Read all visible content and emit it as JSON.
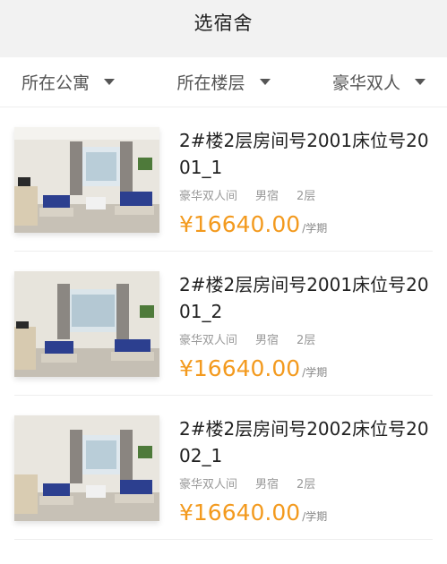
{
  "header": {
    "title": "选宿舍"
  },
  "filters": [
    {
      "label": "所在公寓"
    },
    {
      "label": "所在楼层"
    },
    {
      "label": "豪华双人"
    }
  ],
  "rooms": [
    {
      "title": "2#楼2层房间号2001床位号2001_1",
      "type": "豪华双人间",
      "gender": "男宿",
      "floor": "2层",
      "price": "¥16640.00",
      "unit": "/学期"
    },
    {
      "title": "2#楼2层房间号2001床位号2001_2",
      "type": "豪华双人间",
      "gender": "男宿",
      "floor": "2层",
      "price": "¥16640.00",
      "unit": "/学期"
    },
    {
      "title": "2#楼2层房间号2002床位号2002_1",
      "type": "豪华双人间",
      "gender": "男宿",
      "floor": "2层",
      "price": "¥16640.00",
      "unit": "/学期"
    }
  ],
  "colors": {
    "price": "#f39a1e",
    "bed": "#2c3f8f",
    "background": "#f2f2f2"
  }
}
